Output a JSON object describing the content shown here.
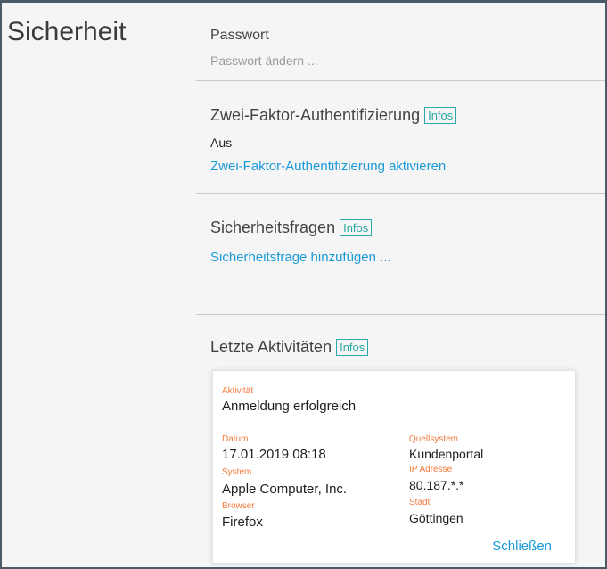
{
  "page_title": "Sicherheit",
  "password": {
    "heading": "Passwort",
    "change_link": "Passwort ändern ..."
  },
  "two_factor": {
    "heading": "Zwei-Faktor-Authentifizierung",
    "info_badge": "Infos",
    "status": "Aus",
    "activate_link": "Zwei-Faktor-Authentifizierung aktivieren"
  },
  "security_questions": {
    "heading": "Sicherheitsfragen",
    "info_badge": "Infos",
    "add_link": "Sicherheitsfrage hinzufügen ..."
  },
  "recent_activity": {
    "heading": "Letzte Aktivitäten",
    "info_badge": "Infos",
    "card": {
      "activity_label": "Aktivität",
      "activity_value": "Anmeldung erfolgreich",
      "date_label": "Datum",
      "date_value": "17.01.2019 08:18",
      "system_label": "System",
      "system_value": "Apple Computer, Inc.",
      "browser_label": "Browser",
      "browser_value": "Firefox",
      "source_label": "Quellsystem",
      "source_value": "Kundenportal",
      "ip_label": "IP Adresse",
      "ip_value": "80.187.*.*",
      "city_label": "Stadt",
      "city_value": "Göttingen",
      "close_label": "Schließen"
    }
  },
  "colors": {
    "link": "#1a9ad7",
    "badge": "#2aa9a6",
    "field_label": "#f07a3a",
    "frame": "#4a5a66"
  }
}
